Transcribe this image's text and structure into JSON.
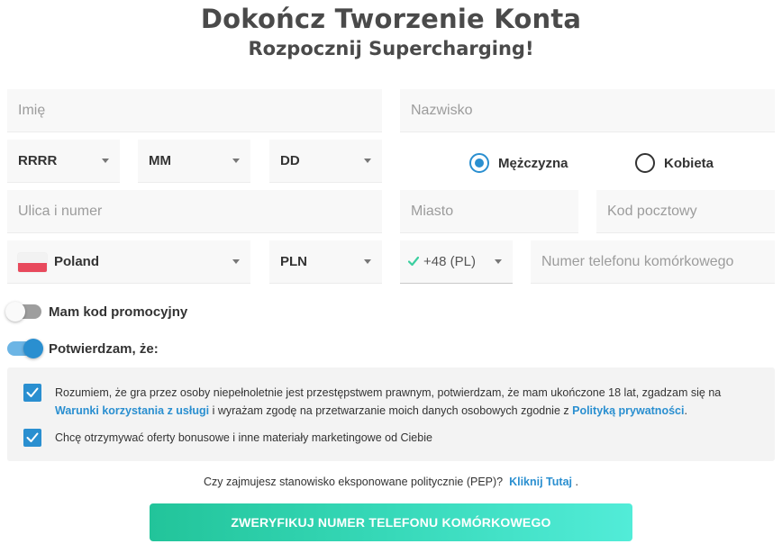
{
  "header": {
    "title": "Dokończ Tworzenie Konta",
    "subtitle": "Rozpocznij Supercharging!"
  },
  "form": {
    "first_name_placeholder": "Imię",
    "last_name_placeholder": "Nazwisko",
    "year_value": "RRRR",
    "month_value": "MM",
    "day_value": "DD",
    "gender": {
      "male_label": "Mężczyzna",
      "female_label": "Kobieta",
      "selected": "Mężczyzna"
    },
    "street_placeholder": "Ulica i numer",
    "city_placeholder": "Miasto",
    "postcode_placeholder": "Kod pocztowy",
    "country_value": "Poland",
    "currency_value": "PLN",
    "phone_prefix_value": "+48 (PL)",
    "phone_placeholder": "Numer telefonu komórkowego"
  },
  "toggles": {
    "promo_label": "Mam kod promocyjny",
    "promo_on": false,
    "confirm_label": "Potwierdzam, że:",
    "confirm_on": true
  },
  "consents": {
    "terms_part1": "Rozumiem, że gra przez osoby niepełnoletnie jest przestępstwem prawnym, potwierdzam, że mam ukończone 18 lat, zgadzam się na",
    "terms_link": "Warunki korzystania z usługi",
    "terms_part2": " i wyrażam zgodę na przetwarzanie moich danych osobowych zgodnie z ",
    "privacy_link": "Polityką prywatności",
    "terms_part3": ".",
    "marketing_text": "Chcę otrzymywać oferty bonusowe i inne materiały marketingowe od Ciebie"
  },
  "pep": {
    "question": "Czy zajmujesz stanowisko eksponowane politycznie (PEP)?",
    "link": "Kliknij Tutaj",
    "suffix": " ."
  },
  "cta": {
    "label": "ZWERYFIKUJ NUMER TELEFONU KOMÓRKOWEGO"
  },
  "colors": {
    "accent": "#2a8fd0",
    "cta_start": "#22c49a",
    "cta_end": "#52ecd8",
    "flag_red": "#e8495c",
    "valid_check": "#3ccfa0"
  }
}
